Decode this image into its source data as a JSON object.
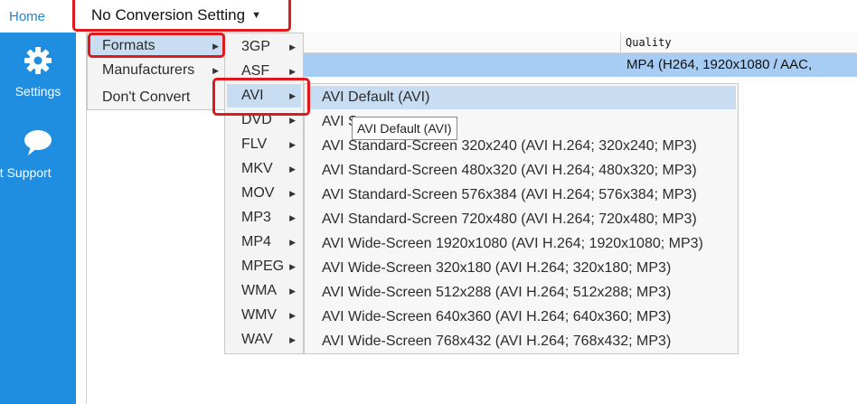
{
  "topbar": {
    "home_label": "Home",
    "conversion_select_value": "No Conversion Setting"
  },
  "sidebar": {
    "items": [
      {
        "label": "Settings",
        "icon": "gear-icon"
      },
      {
        "label": "et Support",
        "icon": "chat-bubble-icon"
      }
    ]
  },
  "table": {
    "quality_header": "Quality",
    "selected_row_quality": "MP4 (H264, 1920x1080 / AAC,"
  },
  "menu_level1": {
    "items": [
      "Formats",
      "Manufacturers",
      "Don't Convert"
    ]
  },
  "menu_level2": {
    "items": [
      "3GP",
      "ASF",
      "AVI",
      "DVD",
      "FLV",
      "MKV",
      "MOV",
      "MP3",
      "MP4",
      "MPEG",
      "WMA",
      "WMV",
      "WAV"
    ]
  },
  "menu_level3": {
    "items": [
      "AVI Default (AVI)",
      "AVI S",
      "AVI Standard-Screen 320x240 (AVI H.264; 320x240; MP3)",
      "AVI Standard-Screen 480x320 (AVI H.264; 480x320; MP3)",
      "AVI Standard-Screen 576x384 (AVI H.264; 576x384; MP3)",
      "AVI Standard-Screen 720x480 (AVI H.264; 720x480; MP3)",
      "AVI Wide-Screen 1920x1080 (AVI H.264; 1920x1080; MP3)",
      "AVI Wide-Screen 320x180 (AVI H.264; 320x180; MP3)",
      "AVI Wide-Screen 512x288 (AVI H.264; 512x288; MP3)",
      "AVI Wide-Screen 640x360 (AVI H.264; 640x360; MP3)",
      "AVI Wide-Screen 768x432 (AVI H.264; 768x432; MP3)"
    ]
  },
  "tooltip": {
    "text": "AVI Default (AVI)"
  },
  "colors": {
    "sidebar_bg": "#1f8de0",
    "home_text": "#1f86d6",
    "selected_row": "#a8cdf4",
    "menu_highlight": "#c9ddf2",
    "annotation_red": "#e0191c"
  }
}
